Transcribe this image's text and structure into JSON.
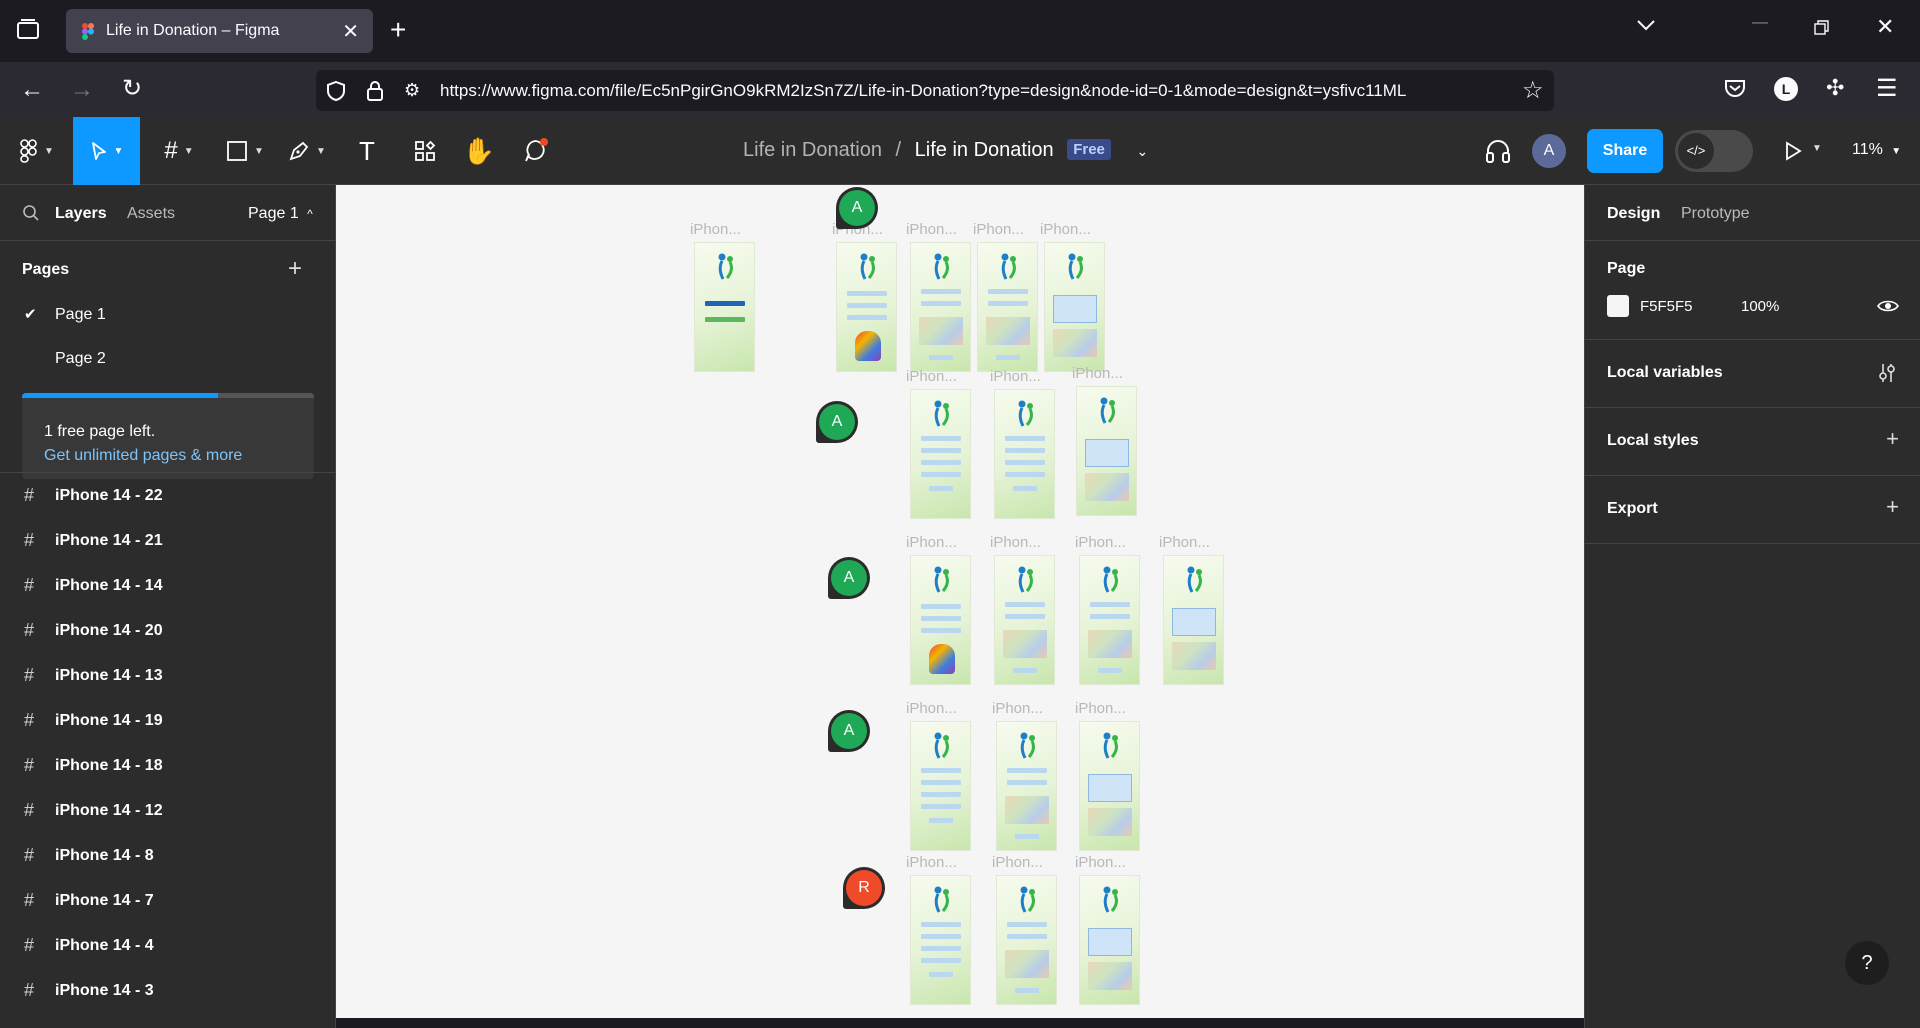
{
  "browser": {
    "tab_title": "Life in Donation – Figma",
    "url": "https://www.figma.com/file/Ec5nPgirGnO9kRM2IzSn7Z/Life-in-Donation?type=design&node-id=0-1&mode=design&t=ysfivc11ML"
  },
  "toolbar": {
    "project": "Life in Donation",
    "separator": "/",
    "file": "Life in Donation",
    "plan_badge": "Free",
    "avatar_initial": "A",
    "share_label": "Share",
    "devmode_glyph": "</>",
    "zoom": "11%"
  },
  "left_panel": {
    "tabs": {
      "layers": "Layers",
      "assets": "Assets",
      "page_selector": "Page 1"
    },
    "pages_header": "Pages",
    "pages": [
      "Page 1",
      "Page 2"
    ],
    "upgrade": {
      "progress": 0.67,
      "text": "1 free page left.",
      "link": "Get unlimited pages & more"
    },
    "layers": [
      "iPhone 14 - 22",
      "iPhone 14 - 21",
      "iPhone 14 - 14",
      "iPhone 14 - 20",
      "iPhone 14 - 13",
      "iPhone 14 - 19",
      "iPhone 14 - 18",
      "iPhone 14 - 12",
      "iPhone 14 - 8",
      "iPhone 14 - 7",
      "iPhone 14 - 4",
      "iPhone 14 - 3"
    ]
  },
  "canvas": {
    "frame_label": "iPhon...",
    "cursors": [
      "A",
      "A",
      "A",
      "A",
      "R"
    ],
    "cursor_colors": {
      "A": "#1fa855",
      "R": "#ef4a2a"
    }
  },
  "right_panel": {
    "tabs": {
      "design": "Design",
      "prototype": "Prototype"
    },
    "page_title": "Page",
    "page_color": "F5F5F5",
    "page_opacity": "100%",
    "local_variables": "Local variables",
    "local_styles": "Local styles",
    "export": "Export"
  },
  "help_label": "?"
}
